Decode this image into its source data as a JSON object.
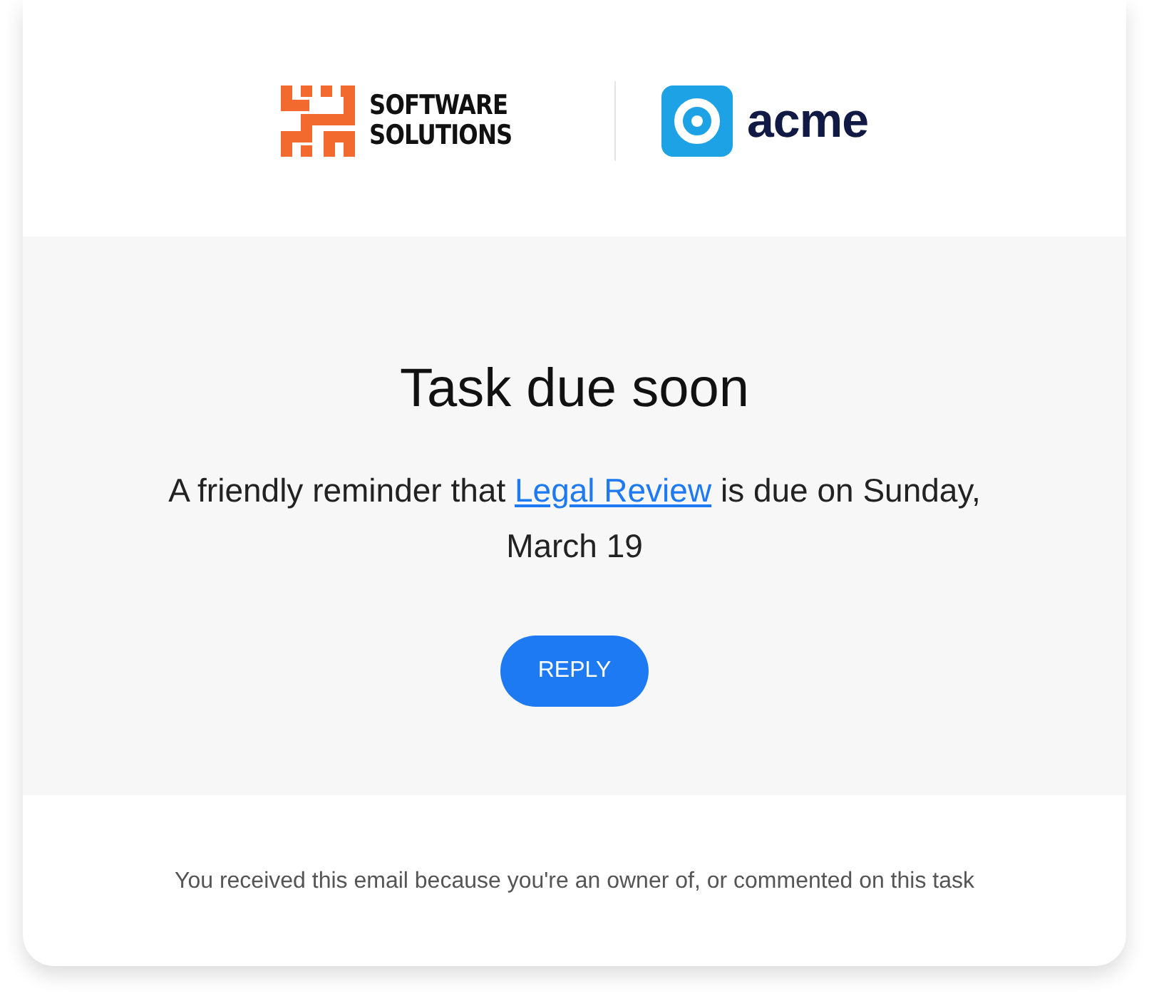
{
  "header": {
    "brand_left": {
      "lines": [
        "SOFTWARE",
        "SOLUTIONS"
      ]
    },
    "brand_right": {
      "name": "acme"
    }
  },
  "body": {
    "title": "Task due soon",
    "message": {
      "before": "A friendly reminder that ",
      "link": "Legal Review",
      "after": " is due on Sunday, March 19"
    },
    "button": "REPLY"
  },
  "footer": {
    "note": "You received this email because you're an owner of, or commented on this task"
  }
}
